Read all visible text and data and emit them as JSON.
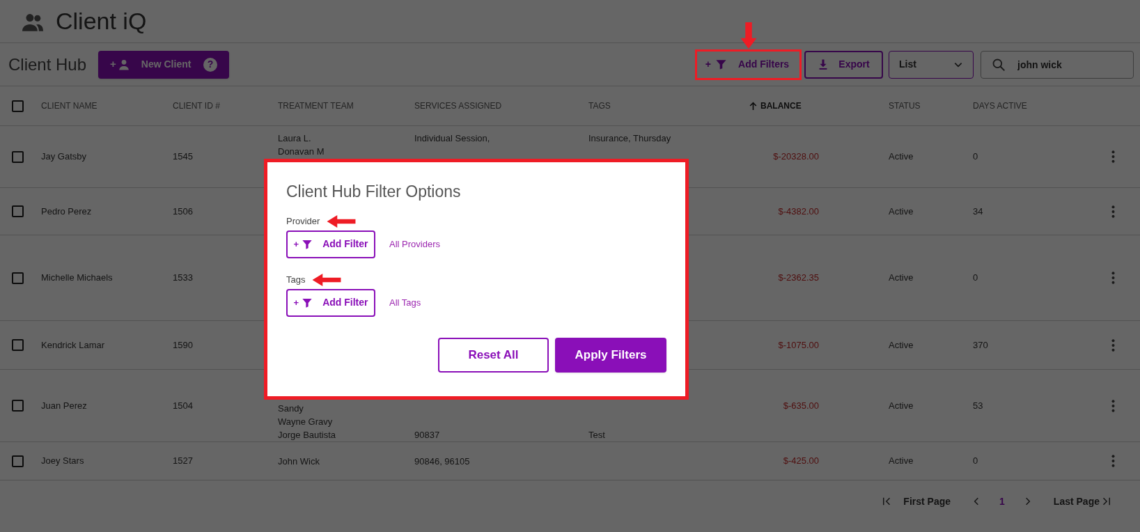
{
  "app": {
    "title": "Client iQ"
  },
  "toolbar": {
    "title": "Client Hub",
    "new_client": {
      "prefix": "+",
      "label": "New Client",
      "help": "?"
    },
    "add_filters": {
      "prefix": "+",
      "label": "Add Filters",
      "highlighted": true
    },
    "export": {
      "label": "Export"
    },
    "view_select": {
      "value": "List"
    },
    "search": {
      "value": "john wick"
    }
  },
  "table": {
    "select_all": {
      "checked": false
    },
    "columns": [
      {
        "label": "CLIENT NAME",
        "sorted": false
      },
      {
        "label": "CLIENT ID #",
        "sorted": false
      },
      {
        "label": "TREATMENT TEAM",
        "sorted": false
      },
      {
        "label": "SERVICES ASSIGNED",
        "sorted": false
      },
      {
        "label": "TAGS",
        "sorted": false
      },
      {
        "label": "BALANCE",
        "sorted": true
      },
      {
        "label": "STATUS",
        "sorted": false
      },
      {
        "label": "DAYS ACTIVE",
        "sorted": false
      }
    ],
    "rows": [
      {
        "checked": false,
        "client_name": "Jay Gatsby",
        "client_id": "1545",
        "treatment_team": [
          "Laura L.",
          "Donavan M"
        ],
        "services": [
          "Individual Session,"
        ],
        "tags": [
          "Insurance, Thursday"
        ],
        "balance": "$-20328.00",
        "status": "Active",
        "days_active": "0"
      },
      {
        "checked": false,
        "client_name": "Pedro Perez",
        "client_id": "1506",
        "balance": "$-4382.00",
        "status": "Active",
        "days_active": "34"
      },
      {
        "checked": false,
        "client_name": "Michelle Michaels",
        "client_id": "1533",
        "balance": "$-2362.35",
        "status": "Active",
        "days_active": "0"
      },
      {
        "checked": false,
        "client_name": "Kendrick Lamar",
        "client_id": "1590",
        "balance": "$-1075.00",
        "status": "Active",
        "days_active": "370"
      },
      {
        "checked": false,
        "client_name": "Juan Perez",
        "client_id": "1504",
        "treatment_team": [
          "Sandy",
          "Wayne Gravy",
          "Jorge Bautista"
        ],
        "services": [
          "90837"
        ],
        "tags": [
          "Test"
        ],
        "balance": "$-635.00",
        "status": "Active",
        "days_active": "53"
      },
      {
        "checked": false,
        "client_name": "Joey Stars",
        "client_id": "1527",
        "treatment_team": [
          "John Wick"
        ],
        "services": [
          "90846, 96105"
        ],
        "balance": "$-425.00",
        "status": "Active",
        "days_active": "0"
      }
    ]
  },
  "pagination": {
    "first": "First Page",
    "page": "1",
    "last": "Last Page"
  },
  "modal": {
    "title": "Client Hub Filter Options",
    "highlighted": true,
    "sections": [
      {
        "label": "Provider",
        "highlighted": true,
        "button": {
          "prefix": "+",
          "label": "Add Filter"
        },
        "link": "All Providers"
      },
      {
        "label": "Tags",
        "highlighted": true,
        "button": {
          "prefix": "+",
          "label": "Add Filter"
        },
        "link": "All Tags"
      }
    ],
    "reset_button": "Reset All",
    "apply_button": "Apply Filters"
  }
}
